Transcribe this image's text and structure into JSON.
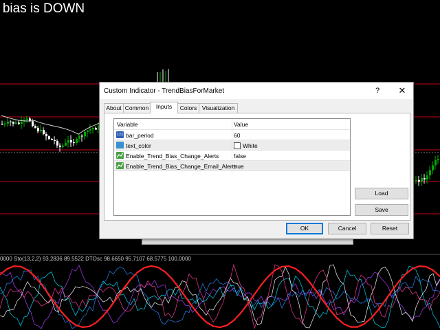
{
  "chart": {
    "bias_text": "d bias is DOWN",
    "oscillator_label": "0000  Sto(13,2,2) 93.2836 89.5522  DTOsc 98.6650 95.7107 68.5775 100.0000",
    "colors": {
      "background": "#000000",
      "level_line": "#c8001e",
      "candle_up": "#00aa00",
      "candle_down": "#ffffff",
      "stoch_main": "#ff2020",
      "osc_lines": [
        "#2b8cff",
        "#b040ff",
        "#00e0ff",
        "#ffffff",
        "#ff40a0"
      ]
    }
  },
  "dialog": {
    "title": "Custom Indicator - TrendBiasForMarket",
    "help_label": "?",
    "close_label": "✕",
    "tabs": [
      {
        "label": "About",
        "active": false
      },
      {
        "label": "Common",
        "active": false
      },
      {
        "label": "Inputs",
        "active": true
      },
      {
        "label": "Colors",
        "active": false
      },
      {
        "label": "Visualization",
        "active": false
      }
    ],
    "grid": {
      "header_variable": "Variable",
      "header_value": "Value",
      "rows": [
        {
          "icon": "numeric-123-icon",
          "icon_text": "123",
          "name": "bar_period",
          "value": "60"
        },
        {
          "icon": "color-palette-icon",
          "name": "text_color",
          "value": "White",
          "swatch": "#ffffff"
        },
        {
          "icon": "boolean-chart-icon",
          "name": "Enable_Trend_Bias_Change_Alerts",
          "value": "false"
        },
        {
          "icon": "boolean-chart-icon",
          "name": "Enable_Trend_Bias_Change_Email_Alerts",
          "value": "true"
        }
      ]
    },
    "buttons": {
      "load": "Load",
      "save": "Save",
      "ok": "OK",
      "cancel": "Cancel",
      "reset": "Reset"
    }
  }
}
